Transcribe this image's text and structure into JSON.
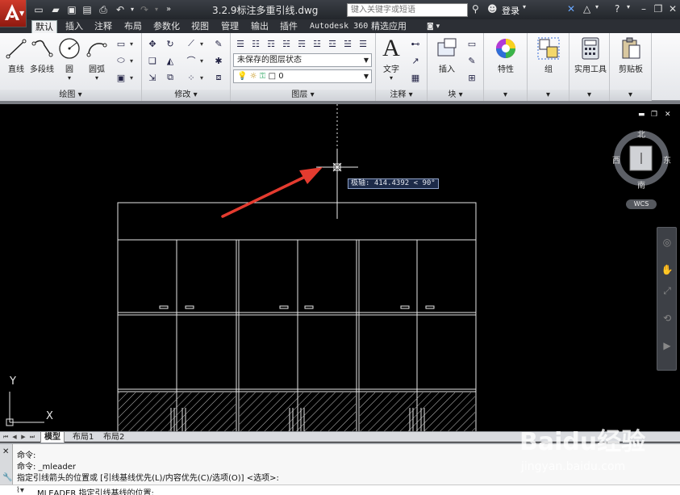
{
  "titlebar": {
    "doc_title": "3.2.9标注多重引线.dwg",
    "search_placeholder": "键入关键字或短语",
    "login_label": "登录"
  },
  "tabs": [
    "默认",
    "插入",
    "注释",
    "布局",
    "参数化",
    "视图",
    "管理",
    "输出",
    "插件",
    "Autodesk 360",
    "精选应用"
  ],
  "ribbon": {
    "draw": {
      "title": "绘图",
      "line": "直线",
      "polyline": "多段线",
      "circle": "圆",
      "arc": "圆弧"
    },
    "modify": {
      "title": "修改"
    },
    "layers": {
      "title": "图层",
      "layer_state": "未保存的图层状态",
      "current_layer": "0"
    },
    "annotation": {
      "title": "注释",
      "text": "文字"
    },
    "block": {
      "title": "块",
      "insert": "插入"
    },
    "properties": {
      "label": "特性"
    },
    "groups": {
      "label": "组"
    },
    "utilities": {
      "label": "实用工具"
    },
    "clipboard": {
      "label": "剪贴板"
    }
  },
  "canvas": {
    "polar_tooltip": "极轴: 414.4392 < 90°",
    "viewcube": {
      "north": "北",
      "south": "南",
      "east": "东",
      "west": "西",
      "wcs": "WCS"
    },
    "ucs": {
      "y": "Y",
      "x": "X"
    }
  },
  "layout_tabs": [
    "模型",
    "布局1",
    "布局2"
  ],
  "command": {
    "history": [
      "命令:",
      "命令:  _mleader",
      "指定引线箭头的位置或 [引线基线优先(L)/内容优先(C)/选项(O)] <选项>:"
    ],
    "prompt": "MLEADER 指定引线基线的位置:"
  },
  "watermark": {
    "logo": "Baidu经验",
    "url": "jingyan.baidu.com"
  }
}
